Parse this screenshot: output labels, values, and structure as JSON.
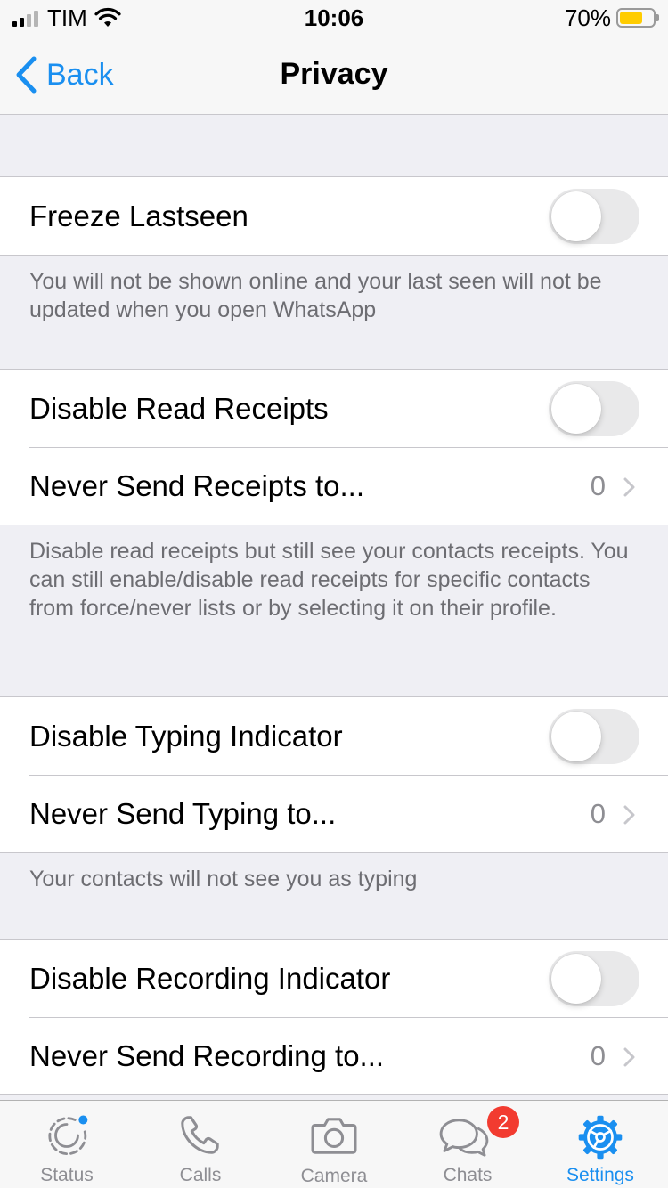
{
  "status_bar": {
    "carrier": "TIM",
    "time": "10:06",
    "battery_percent_label": "70%",
    "battery_level": 0.7,
    "battery_color": "#ffcc00"
  },
  "nav": {
    "back_label": "Back",
    "title": "Privacy",
    "accent_color": "#1a8ff0"
  },
  "sections": {
    "freeze": {
      "toggle_label": "Freeze Lastseen",
      "toggle_on": false,
      "footer": "You will not be shown online and your last seen will not be updated when you open WhatsApp"
    },
    "read_receipts": {
      "toggle_label": "Disable Read Receipts",
      "toggle_on": false,
      "link_label": "Never Send Receipts to...",
      "link_value": "0",
      "footer": "Disable read receipts but still see your contacts receipts. You can still enable/disable read receipts for specific contacts from force/never lists or by selecting it on their profile."
    },
    "typing": {
      "toggle_label": "Disable Typing Indicator",
      "toggle_on": false,
      "link_label": "Never Send Typing to...",
      "link_value": "0",
      "footer": "Your contacts will not see you as typing"
    },
    "recording": {
      "toggle_label": "Disable Recording Indicator",
      "toggle_on": false,
      "link_label": "Never Send Recording to...",
      "link_value": "0"
    }
  },
  "tab_bar": {
    "status": {
      "label": "Status",
      "icon": "status-icon"
    },
    "calls": {
      "label": "Calls",
      "icon": "phone-icon"
    },
    "camera": {
      "label": "Camera",
      "icon": "camera-icon"
    },
    "chats": {
      "label": "Chats",
      "icon": "chat-bubbles-icon",
      "badge": "2"
    },
    "settings": {
      "label": "Settings",
      "icon": "gear-icon",
      "selected": true
    }
  }
}
